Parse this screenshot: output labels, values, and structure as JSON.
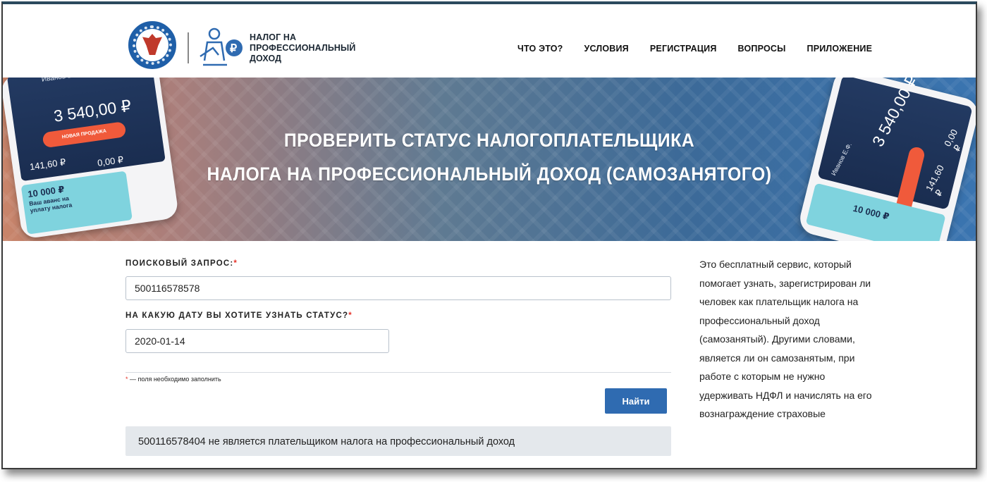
{
  "header": {
    "logo_lines": [
      "НАЛОГ НА",
      "ПРОФЕССИОНАЛЬНЫЙ",
      "ДОХОД"
    ],
    "nav": [
      "ЧТО ЭТО?",
      "УСЛОВИЯ",
      "РЕГИСТРАЦИЯ",
      "ВОПРОСЫ",
      "ПРИЛОЖЕНИЕ"
    ]
  },
  "banner": {
    "title_line1": "ПРОВЕРИТЬ СТАТУС НАЛОГОПЛАТЕЛЬЩИКА",
    "title_line2": "НАЛОГА НА ПРОФЕССИОНАЛЬНЫЙ ДОХОД (САМОЗАНЯТОГО)",
    "phone_left": {
      "user": "Иванов Е.Ф.",
      "amount": "3 540,00 ₽",
      "button": "НОВАЯ ПРОДАЖА",
      "value1": "141,60 ₽",
      "value2": "0,00 ₽",
      "card_amount": "10 000 ₽",
      "card_note": "Ваш аванс на уплату налога"
    },
    "phone_right": {
      "user": "Иванов Е.Ф.",
      "amount": "3 540,00 ₽",
      "value1": "141,60 ₽",
      "value2": "0,00 ₽",
      "card_amount": "10 000 ₽"
    }
  },
  "form": {
    "query_label": "ПОИСКОВЫЙ ЗАПРОС:",
    "query_value": "500116578578",
    "date_label": "НА КАКУЮ ДАТУ ВЫ ХОТИТЕ УЗНАТЬ СТАТУС?",
    "date_value": "2020-01-14",
    "required_mark": "*",
    "required_note": "— поля необходимо заполнить",
    "submit_label": "Найти",
    "result_text": "500116578404 не является плательщиком налога на профессиональный доход"
  },
  "aside": {
    "text": "Это бесплатный сервис, который помогает узнать, зарегистрирован ли человек как плательщик налога на профессиональный доход (самозанятый). Другими словами, является ли он самозанятым, при работе с которым не нужно удерживать НДФЛ и начислять на его вознаграждение страховые"
  },
  "colors": {
    "primary_button": "#2f6bb1",
    "required": "#e5332a",
    "result_bg": "#e4e8ec"
  }
}
